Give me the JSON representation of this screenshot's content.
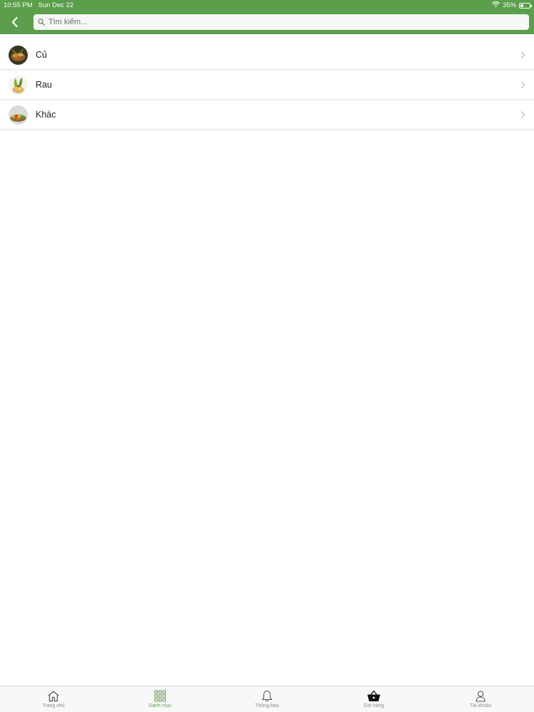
{
  "status_bar": {
    "time": "10:55 PM",
    "date": "Sun Dec 22",
    "battery_percent": "35%",
    "battery_level": 0.35
  },
  "header": {
    "search_placeholder": "Tìm kiếm...",
    "accent_color": "#5b9e4b"
  },
  "categories": [
    {
      "label": "Củ",
      "icon": "root-vegetables-photo"
    },
    {
      "label": "Rau",
      "icon": "leafy-vegetables-photo"
    },
    {
      "label": "Khác",
      "icon": "other-products-photo"
    }
  ],
  "tab_bar": {
    "active": "Danh mục",
    "items": [
      {
        "label": "Trang chủ",
        "icon": "home-icon"
      },
      {
        "label": "Danh mục",
        "icon": "grid-icon"
      },
      {
        "label": "Thông báo",
        "icon": "bell-icon"
      },
      {
        "label": "Giỏ hàng",
        "icon": "basket-icon"
      },
      {
        "label": "Tài khoản",
        "icon": "user-icon"
      }
    ]
  }
}
